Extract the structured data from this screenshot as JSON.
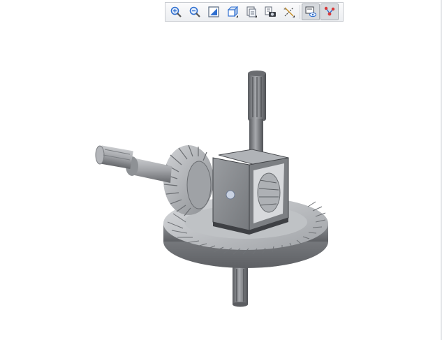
{
  "toolbar": {
    "buttons": [
      {
        "name": "zoom-in-button",
        "icon": "zoom-in-icon"
      },
      {
        "name": "zoom-out-button",
        "icon": "zoom-out-icon"
      },
      {
        "name": "refit-button",
        "icon": "refit-icon"
      },
      {
        "name": "display-style-button",
        "icon": "display-style-icon"
      },
      {
        "name": "saved-views-button",
        "icon": "saved-views-icon"
      },
      {
        "name": "view-manager-button",
        "icon": "view-manager-icon"
      },
      {
        "name": "datum-display-button",
        "icon": "datum-display-icon"
      },
      {
        "name": "spin-center-button",
        "icon": "spin-center-icon"
      },
      {
        "name": "annotation-display-button",
        "icon": "annotation-display-icon"
      }
    ]
  },
  "colors": {
    "toolbar_border": "#c9ccd1",
    "model_dark": "#4a4c50",
    "model_mid": "#8a8d92",
    "model_light": "#c4c6ca",
    "accent_blue": "#2f6fd0"
  }
}
